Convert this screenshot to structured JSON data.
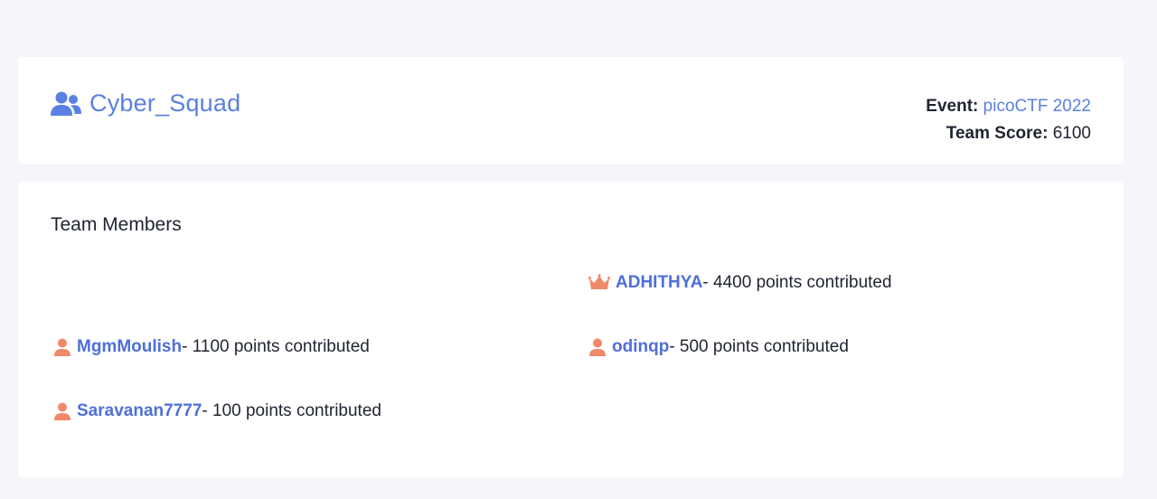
{
  "team": {
    "name": "Cyber_Squad",
    "icon": "users-icon",
    "color": "#5a80e2"
  },
  "event": {
    "event_label": "Event:",
    "event_name": "picoCTF 2022",
    "score_label": "Team Score:",
    "score_value": "6100"
  },
  "members": {
    "title": "Team Members",
    "leader": {
      "icon": "crown-icon",
      "username": "ADHITHYA",
      "contribution": " - 4400 points contributed"
    },
    "list": [
      {
        "icon": "user-icon",
        "username": "MgmMoulish",
        "contribution": " - 1100 points contributed"
      },
      {
        "icon": "user-icon",
        "username": "odinqp",
        "contribution": " - 500 points contributed"
      },
      {
        "icon": "user-icon",
        "username": "Saravanan7777",
        "contribution": " - 100 points contributed"
      }
    ]
  },
  "colors": {
    "accent": "#5a80e2",
    "member_icon": "#f0896a",
    "background": "#f5f6fa"
  }
}
